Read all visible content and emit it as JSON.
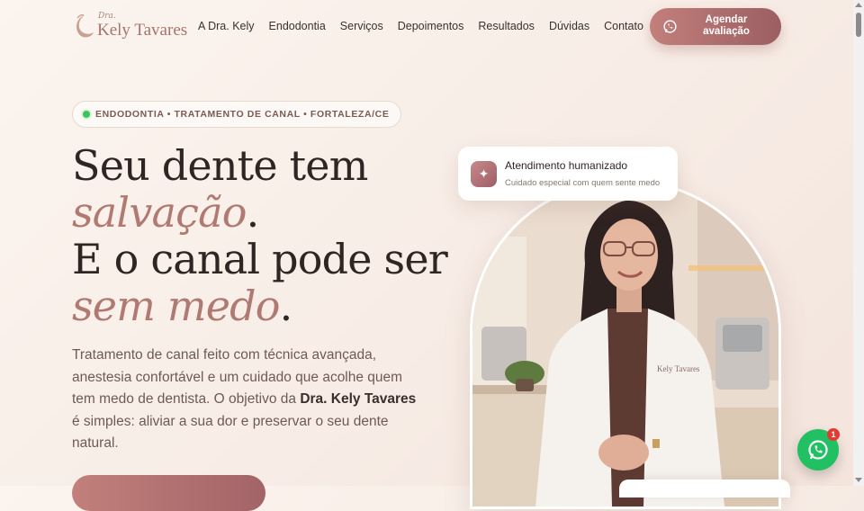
{
  "logo": {
    "small": "Dra.",
    "name": "Kely Tavares"
  },
  "nav": [
    "A Dra. Kely",
    "Endodontia",
    "Serviços",
    "Depoimentos",
    "Resultados",
    "Dúvidas",
    "Contato"
  ],
  "header_cta": {
    "line1": "Agendar",
    "line2": "avaliação",
    "icon": "whatsapp-icon"
  },
  "badge": {
    "text": "ENDODONTIA • TRATAMENTO DE CANAL • FORTALEZA/CE",
    "dot_color": "#3cc45a"
  },
  "headline": {
    "l1": "Seu dente tem",
    "l2_accent": "salvação",
    "l2_end": ".",
    "l3": "E o canal pode ser",
    "l4_accent": "sem medo",
    "l4_end": "."
  },
  "description": {
    "part1": "Tratamento de canal feito com técnica avançada, anestesia confortável e um cuidado que acolhe quem tem medo de dentista. O objetivo da ",
    "name": "Dra. Kely Tavares",
    "part2": " é simples: aliviar a sua dor e preservar o seu dente natural."
  },
  "float_card": {
    "title": "Atendimento humanizado",
    "subtitle": "Cuidado especial com quem sente medo",
    "icon": "sparkle-icon"
  },
  "whatsapp_float": {
    "badge_count": "1",
    "icon": "whatsapp-icon"
  },
  "colors": {
    "accent": "#b07a72",
    "cta_start": "#c27f7b",
    "cta_end": "#9b5e62",
    "whatsapp": "#21c063"
  }
}
